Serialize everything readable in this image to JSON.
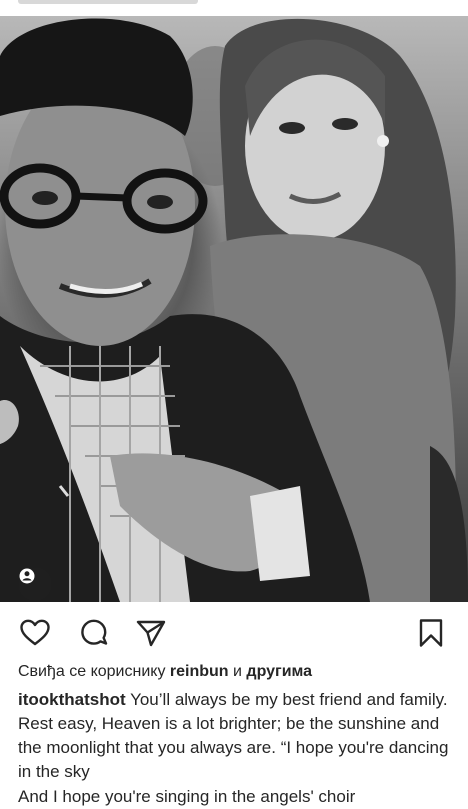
{
  "post": {
    "liked_by_prefix": "Свиђа се кориснику",
    "liked_by_user": "reinbun",
    "liked_by_join": "и",
    "liked_by_others": "другима",
    "author": "itookthatshot",
    "caption": "You’ll always be my best friend and family. Rest easy, Heaven is a lot brighter; be the sunshine and the moonlight that you always are. “I hope you're dancing in the sky",
    "caption_cut_line": "And I hope you're singing in the angels' choir"
  },
  "icons": {
    "like": "heart-outline-icon",
    "comment": "comment-bubble-icon",
    "share": "paper-plane-icon",
    "save": "bookmark-outline-icon",
    "tagged_users": "user-tag-icon"
  },
  "colors": {
    "text": "#262626",
    "background": "#ffffff",
    "icon": "#262626"
  }
}
